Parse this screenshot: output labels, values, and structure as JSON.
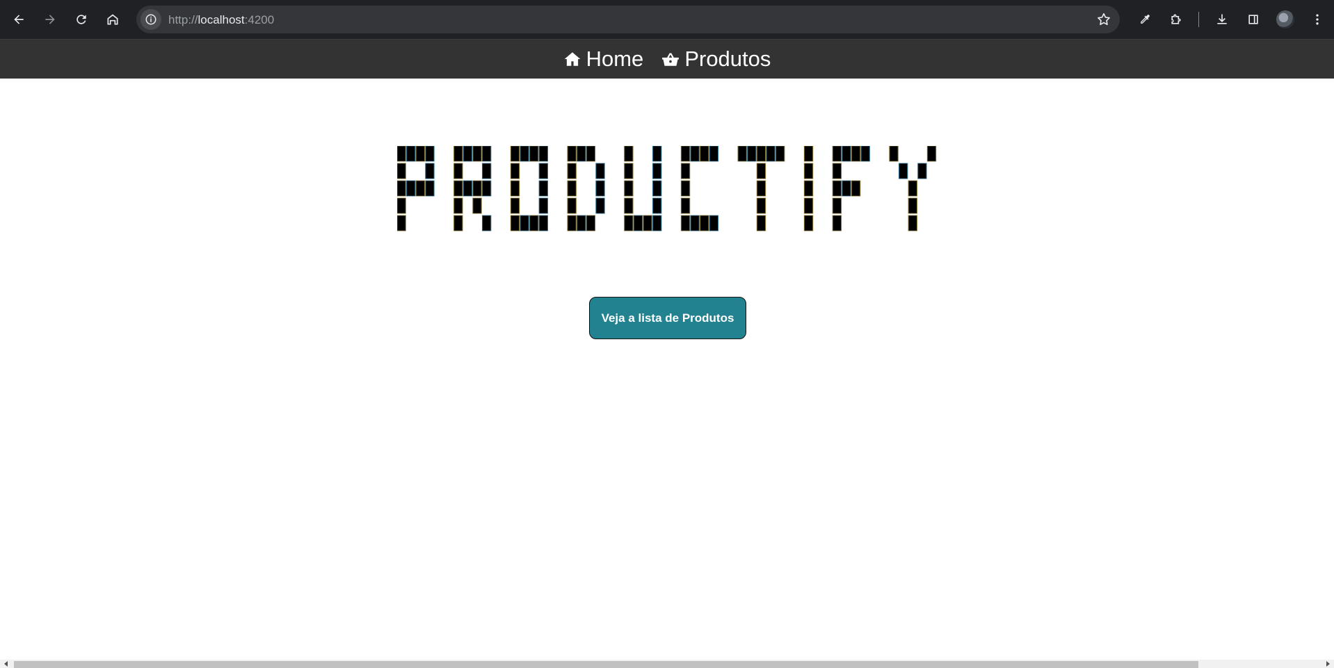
{
  "browser": {
    "url_scheme": "http://",
    "url_host": "localhost",
    "url_port": ":4200",
    "icons": {
      "back": "back-arrow-icon",
      "forward": "forward-arrow-icon",
      "reload": "reload-icon",
      "home": "home-icon",
      "info": "info-icon",
      "bookmark": "star-icon",
      "eyedropper": "eyedropper-icon",
      "extensions": "puzzle-icon",
      "downloads": "download-icon",
      "side_panel": "side-panel-icon",
      "profile": "avatar",
      "menu": "kebab-menu-icon"
    }
  },
  "navbar": {
    "background": "#333333",
    "items": [
      {
        "label": "Home",
        "icon": "home-icon"
      },
      {
        "label": "Produtos",
        "icon": "shopping-basket-icon"
      }
    ]
  },
  "hero": {
    "logo_text": "PRODUCTIFY",
    "button_label": "Veja a lista de Produtos",
    "button_color": "#238290"
  }
}
